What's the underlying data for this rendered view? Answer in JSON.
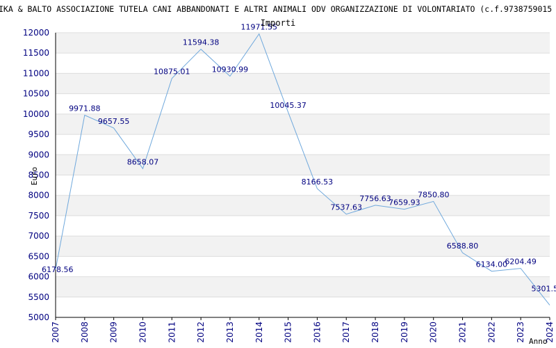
{
  "chart_data": {
    "type": "line",
    "title": "IKA & BALTO ASSOCIAZIONE TUTELA CANI ABBANDONATI E ALTRI ANIMALI ODV ORGANIZZAZIONE DI VOLONTARIATO (c.f.9738759015",
    "subtitle": "Importi",
    "xlabel": "Anno",
    "ylabel": "Euro",
    "ylim": [
      5000,
      12000
    ],
    "yticks": [
      "5000",
      "5500",
      "6000",
      "6500",
      "7000",
      "7500",
      "8000",
      "8500",
      "9000",
      "9500",
      "10000",
      "10500",
      "11000",
      "11500",
      "12000"
    ],
    "categories": [
      "2007",
      "2008",
      "2009",
      "2010",
      "2011",
      "2012",
      "2013",
      "2014",
      "2015",
      "2016",
      "2017",
      "2018",
      "2019",
      "2020",
      "2021",
      "2022",
      "2023",
      "2024"
    ],
    "values": [
      6178.56,
      9971.88,
      9657.55,
      8658.07,
      10875.01,
      11594.38,
      10930.99,
      11971.55,
      10045.37,
      8166.53,
      7537.63,
      7756.63,
      7659.93,
      7850.8,
      6588.8,
      6134.0,
      6204.49,
      5301.5
    ],
    "value_labels": [
      "6178.56",
      "9971.88",
      "9657.55",
      "8658.07",
      "10875.01",
      "11594.38",
      "10930.99",
      "11971.55",
      "10045.37",
      "8166.53",
      "7537.63",
      "7756.63",
      "7659.93",
      "7850.80",
      "6588.80",
      "6134.00",
      "6204.49",
      "5301.5"
    ],
    "grid": "horizontal bands",
    "colors": {
      "line": "#6fa8dc",
      "label": "#000080",
      "band": "#f2f2f2",
      "grid": "#dddddd",
      "axis": "#000000"
    }
  }
}
